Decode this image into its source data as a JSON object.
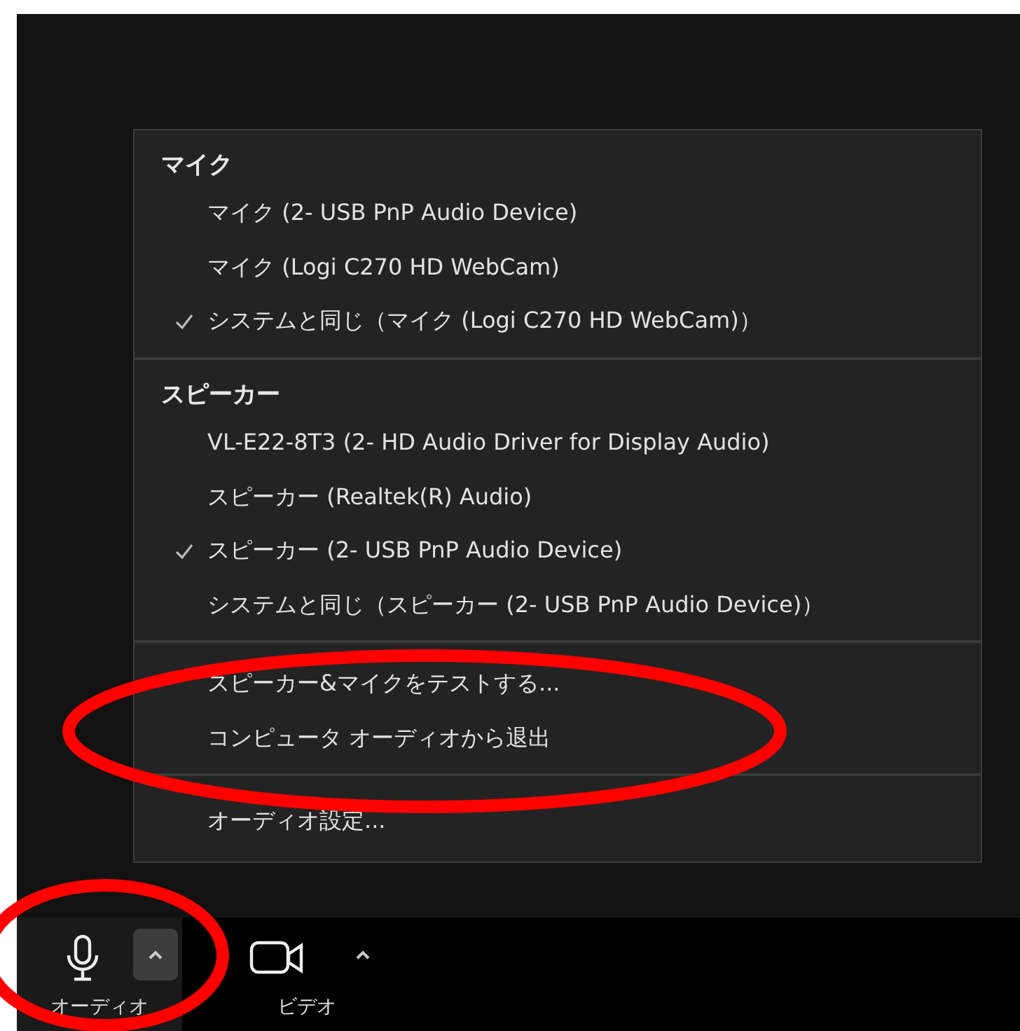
{
  "menu": {
    "sections": [
      {
        "heading": "マイク",
        "items": [
          {
            "label": "マイク (2- USB PnP Audio Device)",
            "checked": false
          },
          {
            "label": "マイク (Logi C270 HD WebCam)",
            "checked": false
          },
          {
            "label": "システムと同じ（マイク (Logi C270 HD WebCam)）",
            "checked": true
          }
        ]
      },
      {
        "heading": "スピーカー",
        "items": [
          {
            "label": "VL-E22-8T3 (2- HD Audio Driver for Display Audio)",
            "checked": false
          },
          {
            "label": "スピーカー (Realtek(R) Audio)",
            "checked": false
          },
          {
            "label": "スピーカー (2- USB PnP Audio Device)",
            "checked": true
          },
          {
            "label": "システムと同じ（スピーカー (2- USB PnP Audio Device)）",
            "checked": false
          }
        ]
      },
      {
        "items": [
          {
            "label": "スピーカー&マイクをテストする..."
          },
          {
            "label": "コンピュータ オーディオから退出"
          }
        ]
      },
      {
        "items": [
          {
            "label": "オーディオ設定..."
          }
        ]
      }
    ]
  },
  "toolbar": [
    {
      "kind": "mic",
      "label": "オーディオ",
      "menu_open": true
    },
    {
      "kind": "camera",
      "label": "ビデオ",
      "menu_open": false
    }
  ],
  "annotations": [
    {
      "kind": "ellipse"
    },
    {
      "kind": "ellipse"
    }
  ]
}
